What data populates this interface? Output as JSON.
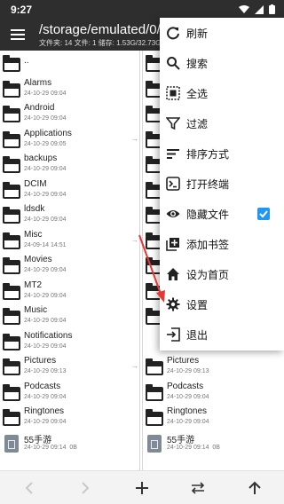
{
  "status_bar": {
    "time": "9:27"
  },
  "toolbar": {
    "path": "/storage/emulated/0/",
    "info": "文件夹: 14  文件: 1  储存: 1.53G/32.73G"
  },
  "left_pane": {
    "parent": "..",
    "items": [
      {
        "name": "Alarms",
        "date": "24-10-29 09:04",
        "type": "folder"
      },
      {
        "name": "Android",
        "date": "24-10-29 09:04",
        "type": "folder"
      },
      {
        "name": "Applications",
        "date": "24-10-29 09:05",
        "type": "folder"
      },
      {
        "name": "backups",
        "date": "24-10-29 09:04",
        "type": "folder"
      },
      {
        "name": "DCIM",
        "date": "24-10-29 09:04",
        "type": "folder"
      },
      {
        "name": "ldsdk",
        "date": "24-10-29 09:04",
        "type": "folder"
      },
      {
        "name": "Misc",
        "date": "24-09-14 14:51",
        "type": "folder"
      },
      {
        "name": "Movies",
        "date": "24-10-29 09:04",
        "type": "folder"
      },
      {
        "name": "MT2",
        "date": "24-10-29 09:04",
        "type": "folder"
      },
      {
        "name": "Music",
        "date": "24-10-29 09:04",
        "type": "folder"
      },
      {
        "name": "Notifications",
        "date": "24-10-29 09:04",
        "type": "folder"
      },
      {
        "name": "Pictures",
        "date": "24-10-29 09:13",
        "type": "folder"
      },
      {
        "name": "Podcasts",
        "date": "24-10-29 09:04",
        "type": "folder"
      },
      {
        "name": "Ringtones",
        "date": "24-10-29 09:04",
        "type": "folder"
      },
      {
        "name": "55手游",
        "date": "24-10-29 09:14",
        "size": "0B",
        "type": "file"
      }
    ]
  },
  "right_pane": {
    "items": [
      {
        "name": "Pictures",
        "date": "24-10-29 09:13",
        "type": "folder"
      },
      {
        "name": "Podcasts",
        "date": "24-10-29 09:04",
        "type": "folder"
      },
      {
        "name": "Ringtones",
        "date": "24-10-29 09:04",
        "type": "folder"
      },
      {
        "name": "55手游",
        "date": "24-10-29 09:14",
        "size": "0B",
        "type": "file"
      }
    ]
  },
  "menu": {
    "items": [
      {
        "label": "刷新",
        "icon": "refresh-icon"
      },
      {
        "label": "搜索",
        "icon": "search-icon"
      },
      {
        "label": "全选",
        "icon": "select-all-icon"
      },
      {
        "label": "过滤",
        "icon": "filter-icon"
      },
      {
        "label": "排序方式",
        "icon": "sort-icon"
      },
      {
        "label": "打开终端",
        "icon": "terminal-icon"
      },
      {
        "label": "隐藏文件",
        "icon": "eye-icon",
        "checked": true
      },
      {
        "label": "添加书签",
        "icon": "bookmark-add-icon"
      },
      {
        "label": "设为首页",
        "icon": "home-icon"
      },
      {
        "label": "设置",
        "icon": "gear-icon"
      },
      {
        "label": "退出",
        "icon": "exit-icon"
      }
    ]
  },
  "colors": {
    "toolbar_bg": "#2e2e2e",
    "checkbox_accent": "#2196f3",
    "annotation_arrow": "#e53935"
  },
  "bottom_bar": {
    "icons": [
      "back-arrow-icon",
      "forward-arrow-icon",
      "add-icon",
      "swap-icon",
      "up-arrow-icon"
    ]
  }
}
